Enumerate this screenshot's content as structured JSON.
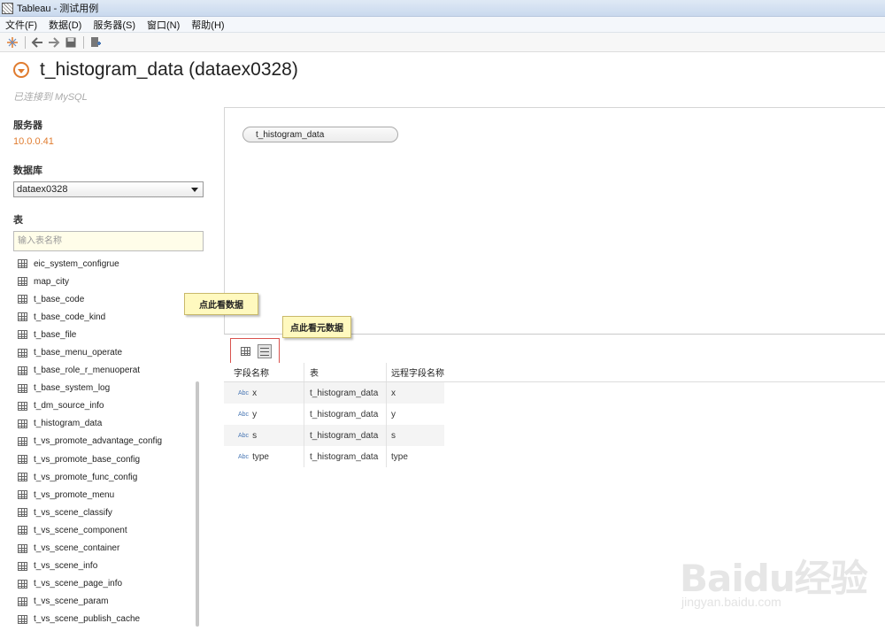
{
  "window": {
    "title": "Tableau - 测试用例"
  },
  "menu": [
    "文件(F)",
    "数据(D)",
    "服务器(S)",
    "窗口(N)",
    "帮助(H)"
  ],
  "toolbar": {
    "icons": [
      "tableau-icon",
      "back-arrow-icon",
      "forward-arrow-icon",
      "save-icon",
      "new-datasource-icon"
    ]
  },
  "header": {
    "title": "t_histogram_data (dataex0328)",
    "connection_status": "已连接到 MySQL"
  },
  "sidebar": {
    "server_label": "服务器",
    "server_value": "10.0.0.41",
    "database_label": "数据库",
    "database_value": "dataex0328",
    "table_label": "表",
    "table_search_placeholder": "输入表名称",
    "tables": [
      "eic_system_configrue",
      "map_city",
      "t_base_code",
      "t_base_code_kind",
      "t_base_file",
      "t_base_menu_operate",
      "t_base_role_r_menuoperat",
      "t_base_system_log",
      "t_dm_source_info",
      "t_histogram_data",
      "t_vs_promote_advantage_config",
      "t_vs_promote_base_config",
      "t_vs_promote_func_config",
      "t_vs_promote_menu",
      "t_vs_scene_classify",
      "t_vs_scene_component",
      "t_vs_scene_container",
      "t_vs_scene_info",
      "t_vs_scene_page_info",
      "t_vs_scene_param",
      "t_vs_scene_publish_cache"
    ]
  },
  "canvas": {
    "table_pill": "t_histogram_data"
  },
  "callouts": {
    "view_data": "点此看数据",
    "view_metadata": "点此看元数据"
  },
  "metadata": {
    "headers": [
      "字段名称",
      "表",
      "远程字段名称"
    ],
    "type_label": "Abc",
    "rows": [
      {
        "field": "x",
        "table": "t_histogram_data",
        "remote": "x"
      },
      {
        "field": "y",
        "table": "t_histogram_data",
        "remote": "y"
      },
      {
        "field": "s",
        "table": "t_histogram_data",
        "remote": "s"
      },
      {
        "field": "type",
        "table": "t_histogram_data",
        "remote": "type"
      }
    ]
  },
  "watermark": {
    "brand": "Baidu经验",
    "url": "jingyan.baidu.com"
  }
}
